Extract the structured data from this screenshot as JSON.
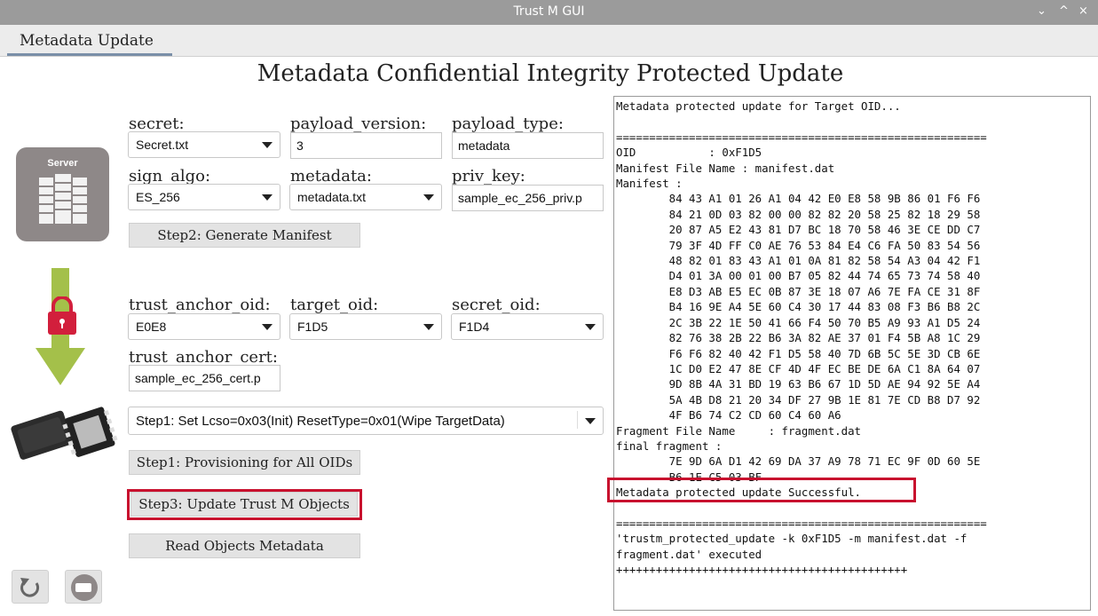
{
  "window": {
    "title": "Trust M GUI",
    "controls": [
      "⌄",
      "^",
      "×"
    ]
  },
  "tabs": [
    {
      "label": "Metadata Update"
    }
  ],
  "page_title": "Metadata Confidential Integrity Protected Update",
  "icons": {
    "server_label": "Server"
  },
  "form": {
    "secret": {
      "label": "secret:",
      "value": "Secret.txt"
    },
    "payload_version": {
      "label": "payload_version:",
      "value": "3"
    },
    "payload_type": {
      "label": "payload_type:",
      "value": "metadata"
    },
    "sign_algo": {
      "label": "sign_algo:",
      "value": "ES_256"
    },
    "metadata": {
      "label": "metadata:",
      "value": "metadata.txt"
    },
    "priv_key": {
      "label": "priv_key:",
      "value": "sample_ec_256_priv.p"
    },
    "trust_anchor_oid": {
      "label": "trust_anchor_oid:",
      "value": "E0E8"
    },
    "target_oid": {
      "label": "target_oid:",
      "value": "F1D5"
    },
    "secret_oid": {
      "label": "secret_oid:",
      "value": "F1D4"
    },
    "trust_anchor_cert": {
      "label": "trust_anchor_cert:",
      "value": "sample_ec_256_cert.p"
    },
    "step1_option": {
      "value": "Step1: Set Lcso=0x03(Init) ResetType=0x01(Wipe TargetData)"
    }
  },
  "buttons": {
    "generate_manifest": "Step2: Generate Manifest",
    "provisioning": "Step1: Provisioning for All OIDs",
    "update_objects": "Step3: Update Trust M Objects",
    "read_metadata": "Read Objects Metadata"
  },
  "console": {
    "text": "Metadata protected update for Target OID...\n\n========================================================\nOID           : 0xF1D5\nManifest File Name : manifest.dat\nManifest :\n        84 43 A1 01 26 A1 04 42 E0 E8 58 9B 86 01 F6 F6\n        84 21 0D 03 82 00 00 82 82 20 58 25 82 18 29 58\n        20 87 A5 E2 43 81 D7 BC 18 70 58 46 3E CE DD C7\n        79 3F 4D FF C0 AE 76 53 84 E4 C6 FA 50 83 54 56\n        48 82 01 83 43 A1 01 0A 81 82 58 54 A3 04 42 F1\n        D4 01 3A 00 01 00 B7 05 82 44 74 65 73 74 58 40\n        E8 D3 AB E5 EC 0B 87 3E 18 07 A6 7E FA CE 31 8F\n        B4 16 9E A4 5E 60 C4 30 17 44 83 08 F3 B6 B8 2C\n        2C 3B 22 1E 50 41 66 F4 50 70 B5 A9 93 A1 D5 24\n        82 76 38 2B 22 B6 3A 82 AE 37 01 F4 5B A8 1C 29\n        F6 F6 82 40 42 F1 D5 58 40 7D 6B 5C 5E 3D CB 6E\n        1C D0 E2 47 8E CF 4D 4F EC BE DE 6A C1 8A 64 07\n        9D 8B 4A 31 BD 19 63 B6 67 1D 5D AE 94 92 5E A4\n        5A 4B D8 21 20 34 DF 27 9B 1E 81 7E CD B8 D7 92\n        4F B6 74 C2 CD 60 C4 60 A6\nFragment File Name     : fragment.dat\nfinal fragment :\n        7E 9D 6A D1 42 69 DA 37 A9 78 71 EC 9F 0D 60 5E\n        B6 1E C5 03 BF\nMetadata protected update Successful.\n\n========================================================\n'trustm_protected_update -k 0xF1D5 -m manifest.dat -f\nfragment.dat' executed\n++++++++++++++++++++++++++++++++++++++++++++"
  }
}
